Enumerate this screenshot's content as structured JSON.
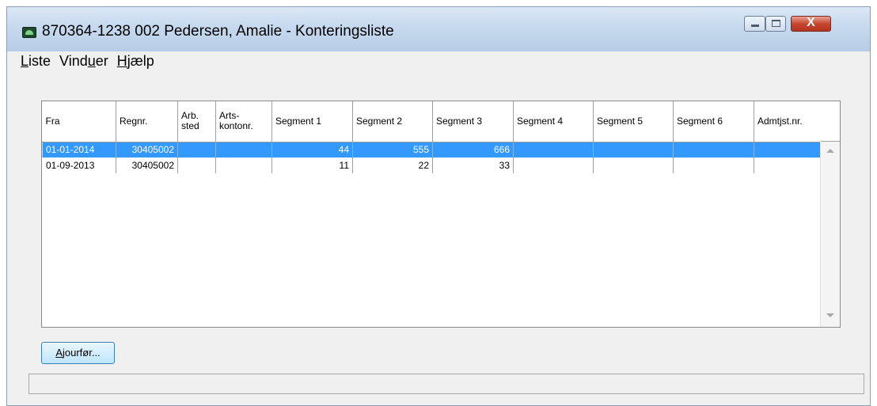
{
  "window": {
    "title": "870364-1238 002 Pedersen, Amalie - Konteringsliste",
    "close_glyph": "X"
  },
  "menu": {
    "items": [
      {
        "underlined": "L",
        "rest": "iste"
      },
      {
        "pre": "Vind",
        "underlined": "u",
        "rest": "er"
      },
      {
        "underlined": "H",
        "rest": "jælp"
      }
    ]
  },
  "table": {
    "headers": [
      "Fra",
      "Regnr.",
      "Arb.\nsted",
      "Arts-\nkontonr.",
      "Segment 1",
      "Segment 2",
      "Segment 3",
      "Segment 4",
      "Segment 5",
      "Segment 6",
      "Admtjst.nr."
    ],
    "rows": [
      {
        "selected": true,
        "cells": [
          "01-01-2014",
          "30405002",
          "",
          "",
          "44",
          "555",
          "666",
          "",
          "",
          "",
          ""
        ]
      },
      {
        "selected": false,
        "cells": [
          "01-09-2013",
          "30405002",
          "",
          "",
          "11",
          "22",
          "33",
          "",
          "",
          "",
          ""
        ]
      }
    ]
  },
  "buttons": {
    "ajour_underlined": "A",
    "ajour_rest": "jourfør..."
  },
  "colors": {
    "selection": "#3399ff",
    "close_button": "#c7452f"
  }
}
